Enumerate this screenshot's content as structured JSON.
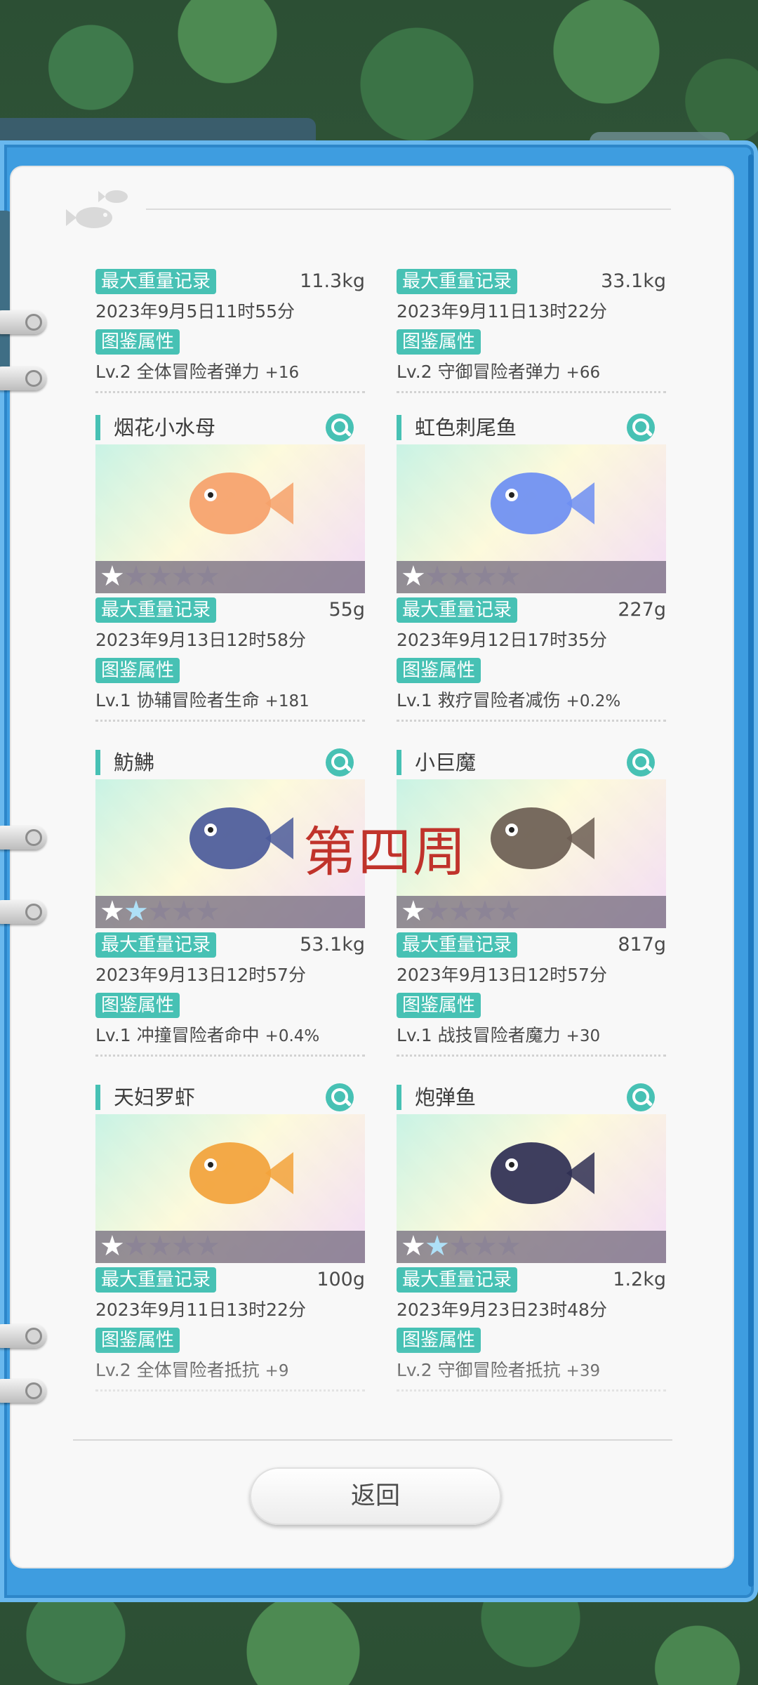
{
  "background": {
    "tab_text": ""
  },
  "record_label": "最大重量记录",
  "attr_label": "图鉴属性",
  "top_cards": [
    {
      "weight": "11.3kg",
      "date": "2023年9月5日11时55分",
      "attr": "Lv.2 全体冒险者弹力",
      "bonus": "+16"
    },
    {
      "weight": "33.1kg",
      "date": "2023年9月11日13时22分",
      "attr": "Lv.2 守御冒险者弹力",
      "bonus": "+66"
    }
  ],
  "cards": [
    {
      "name": "烟花小水母",
      "stars": 1,
      "stars_blue": 0,
      "weight": "55g",
      "date": "2023年9月13日12时58分",
      "attr": "Lv.1 协辅冒险者生命",
      "bonus": "+181",
      "color": "#f6a16a"
    },
    {
      "name": "虹色刺尾鱼",
      "stars": 1,
      "stars_blue": 0,
      "weight": "227g",
      "date": "2023年9月12日17时35分",
      "attr": "Lv.1 救疗冒险者减伤",
      "bonus": "+0.2%",
      "color": "#6d8ef2"
    },
    {
      "name": "魴鮄",
      "stars": 1,
      "stars_blue": 1,
      "weight": "53.1kg",
      "date": "2023年9月13日12时57分",
      "attr": "Lv.1 冲撞冒险者命中",
      "bonus": "+0.4%",
      "color": "#4b5a9a"
    },
    {
      "name": "小巨魔",
      "stars": 1,
      "stars_blue": 0,
      "weight": "817g",
      "date": "2023年9月13日12时57分",
      "attr": "Lv.1 战技冒险者魔力",
      "bonus": "+30",
      "color": "#6b5d52"
    },
    {
      "name": "天妇罗虾",
      "stars": 1,
      "stars_blue": 0,
      "weight": "100g",
      "date": "2023年9月11日13时22分",
      "attr": "Lv.2 全体冒险者抵抗",
      "bonus": "+9",
      "color": "#f2a23a"
    },
    {
      "name": "炮弹鱼",
      "stars": 1,
      "stars_blue": 1,
      "weight": "1.2kg",
      "date": "2023年9月23日23时48分",
      "attr": "Lv.2 守御冒险者抵抗",
      "bonus": "+39",
      "color": "#2e2e52"
    }
  ],
  "watermark": "第四周",
  "back_button": "返回",
  "accent_color": "#47c1b4"
}
